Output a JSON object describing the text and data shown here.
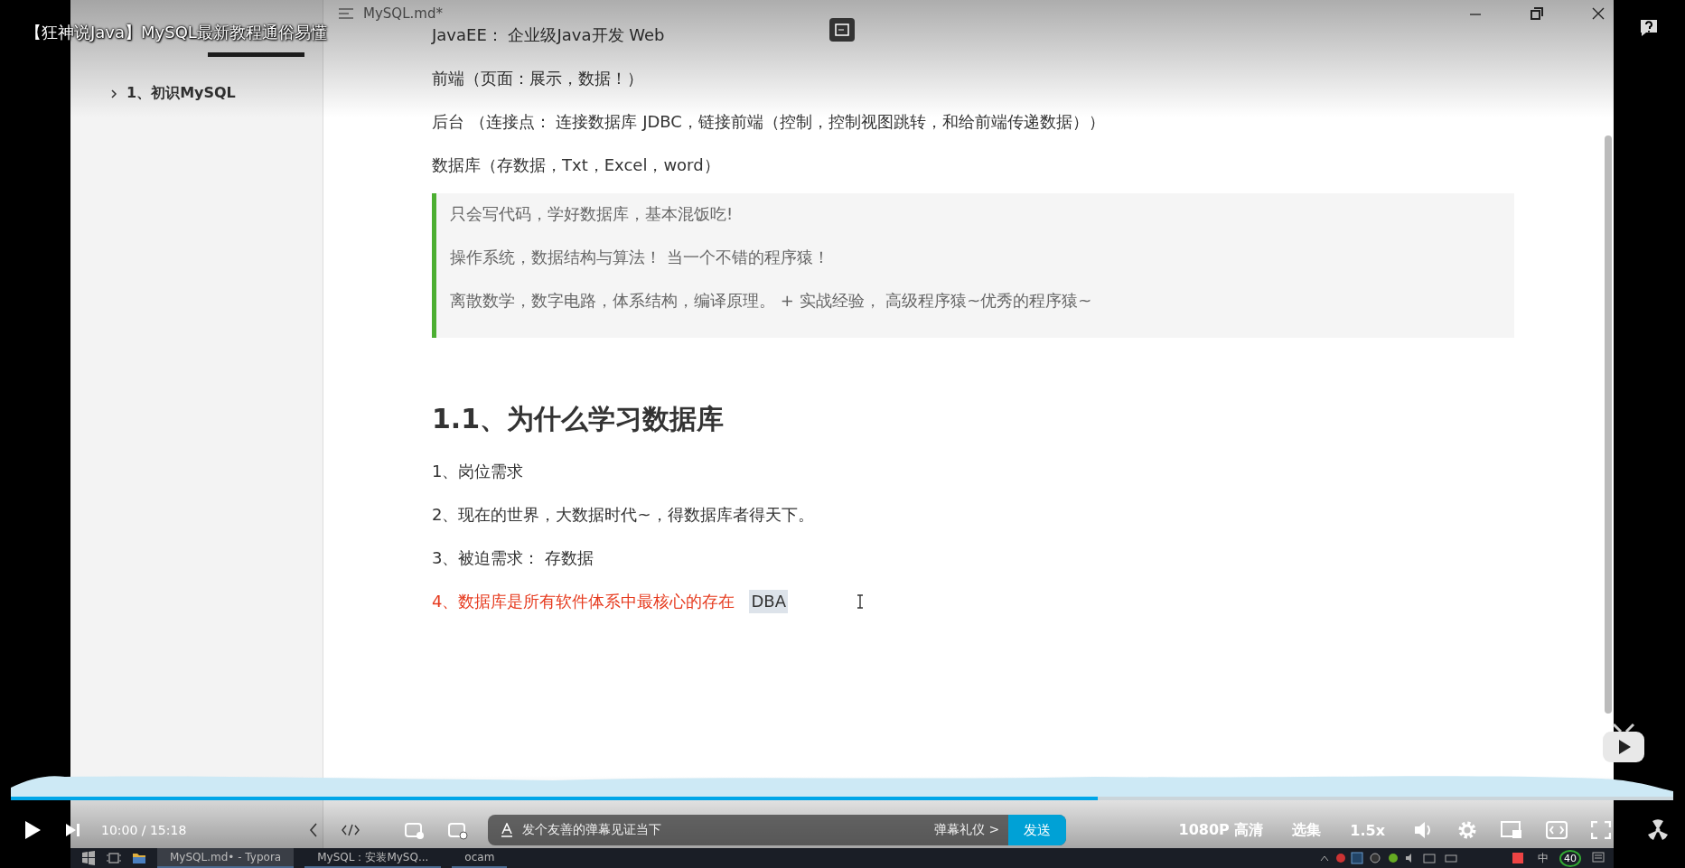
{
  "video_title": "【狂神说Java】MySQL最新教程通俗易懂",
  "typora": {
    "file_tab": "MySQL.md*",
    "outline": [
      {
        "label": "1、初识MySQL",
        "expanded": false
      }
    ],
    "paragraphs": [
      "JavaEE： 企业级Java开发  Web",
      "前端（页面：展示，数据！）",
      "后台 （连接点： 连接数据库 JDBC，链接前端（控制，控制视图跳转，和给前端传递数据））",
      "数据库（存数据，Txt，Excel，word）"
    ],
    "quote": [
      "只会写代码，学好数据库，基本混饭吃!",
      "操作系统，数据结构与算法！ 当一个不错的程序猿！",
      "离散数学，数字电路，体系结构，编译原理。 + 实战经验，    高级程序猿~优秀的程序猿~"
    ],
    "heading": "1.1、为什么学习数据库",
    "list": [
      {
        "kind": "plain",
        "text": "1、岗位需求"
      },
      {
        "kind": "plain",
        "text": "2、现在的世界，大数据时代~，得数据库者得天下。"
      },
      {
        "kind": "plain",
        "text": "3、被迫需求： 存数据"
      },
      {
        "kind": "emphasis",
        "text": "4、数据库是所有软件体系中最核心的存在",
        "highlight": "DBA"
      }
    ]
  },
  "player": {
    "progress": {
      "level": 0.654
    },
    "time": "10:00 / 15:18",
    "danmaku_placeholder": "发个友善的弹幕见证当下",
    "etiquette": "弹幕礼仪 >",
    "send": "发送",
    "quality": "1080P 高清",
    "episodes": "选集",
    "speed": "1.5x"
  },
  "taskbar": {
    "apps": [
      {
        "label": "MySQL.md• - Typora",
        "selected": true
      },
      {
        "label": "MySQL：安装MySQ...",
        "selected": false
      },
      {
        "label": "ocam",
        "selected": false
      }
    ],
    "ime": "中",
    "badge": "40"
  }
}
